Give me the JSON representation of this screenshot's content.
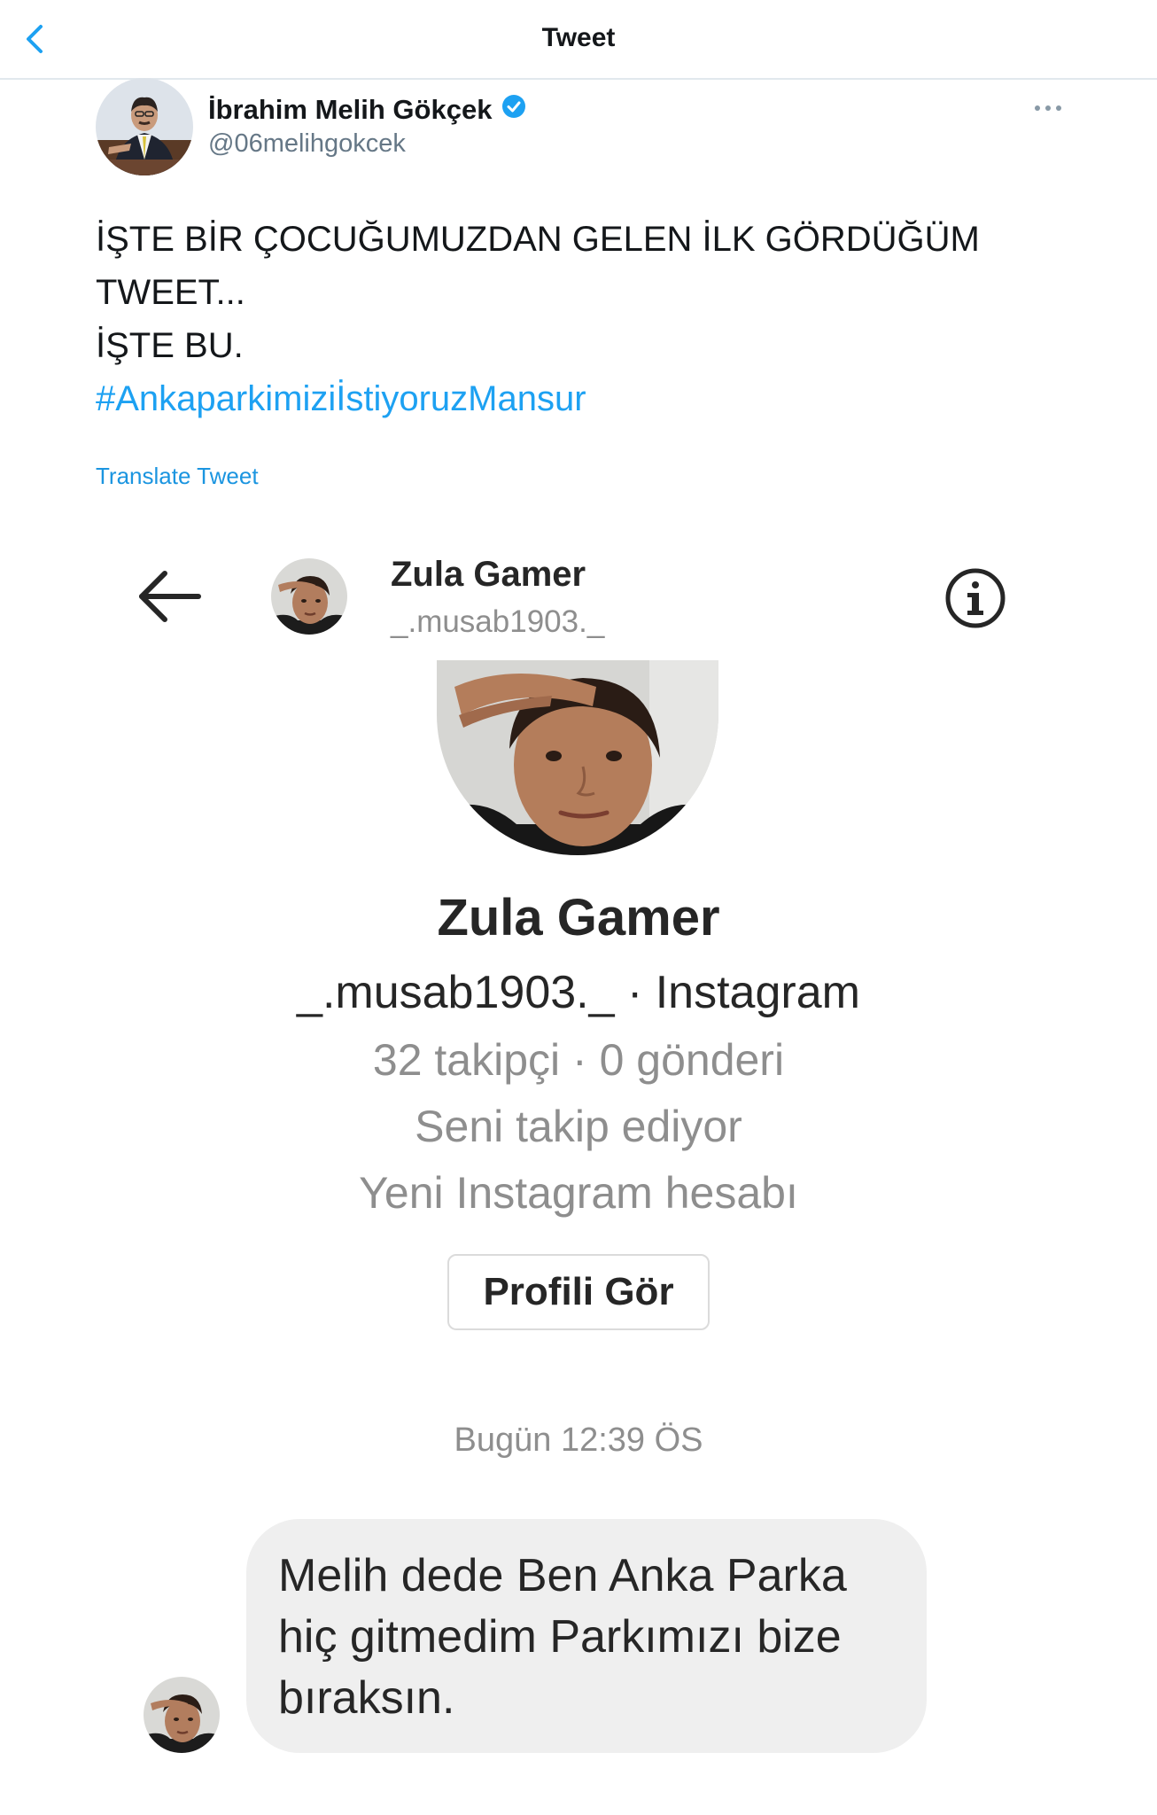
{
  "topbar": {
    "title": "Tweet",
    "back_icon": "chevron-left-icon"
  },
  "tweet": {
    "author_name": "İbrahim Melih Gökçek",
    "author_handle": "@06melihgokcek",
    "verified_icon": "verified-badge-icon",
    "more_icon": "more-dots-icon",
    "text_lines": [
      "İŞTE BİR ÇOCUĞUMUZDAN GELEN İLK GÖRDÜĞÜM",
      "TWEET...",
      "İŞTE BU."
    ],
    "hashtag": "#AnkaparkimiziİstiyoruzMansur",
    "translate_label": "Translate Tweet",
    "link_color": "#1da1f2"
  },
  "instagram_dm": {
    "header": {
      "name": "Zula Gamer",
      "username": "_.musab1903._"
    },
    "profile": {
      "name": "Zula Gamer",
      "subtitle": "_.musab1903._ · Instagram",
      "stats": "32 takipçi · 0 gönderi",
      "follows_you": "Seni takip ediyor",
      "new_account": "Yeni Instagram hesabı",
      "view_profile_button": "Profili Gör"
    },
    "timestamp": "Bugün 12:39 ÖS",
    "message_lines": [
      "Melih dede Ben Anka Parka",
      "hiç gitmedim Parkımızı bize",
      "bıraksın."
    ]
  }
}
